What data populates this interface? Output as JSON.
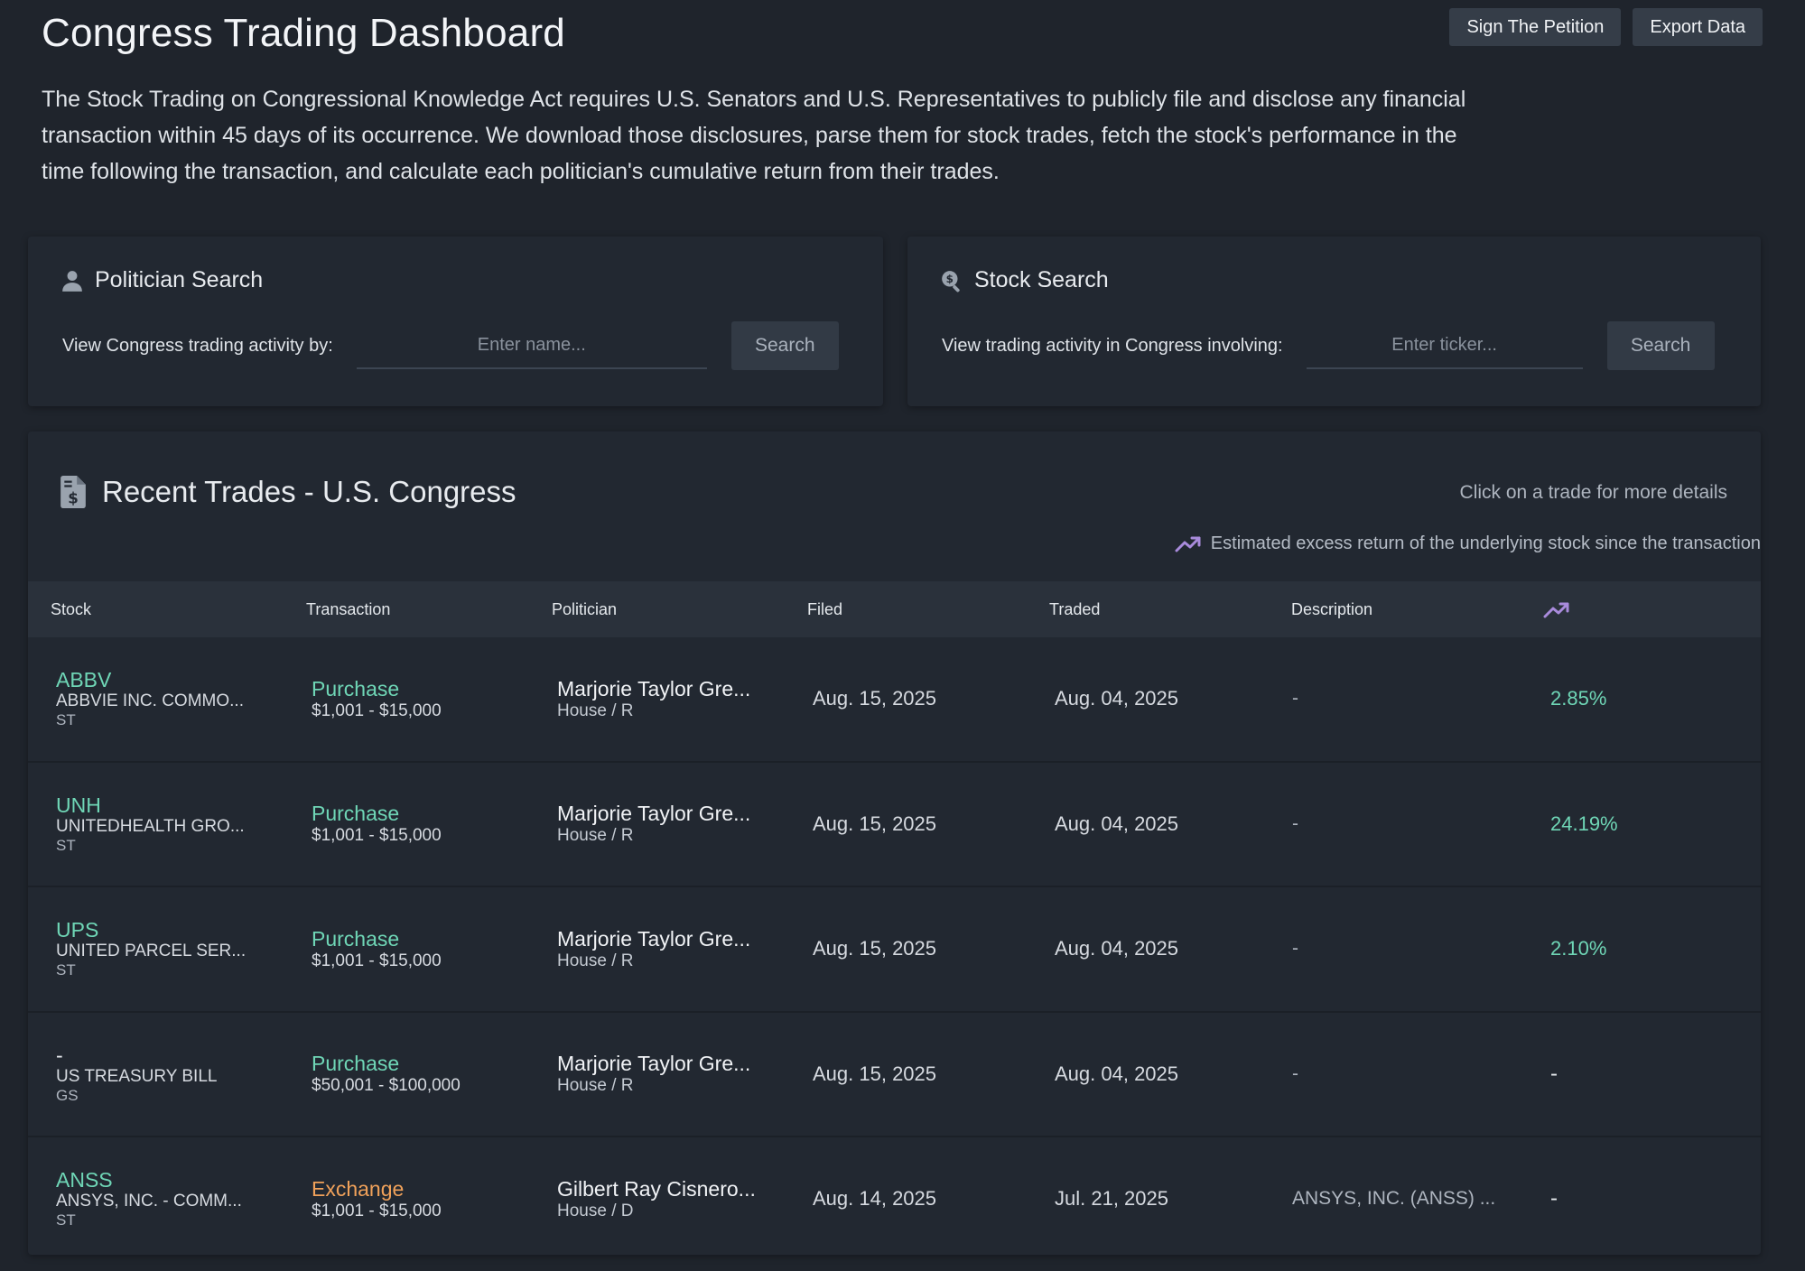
{
  "header": {
    "title": "Congress Trading Dashboard",
    "buttons": {
      "petition": "Sign The Petition",
      "export": "Export Data"
    },
    "intro": "The Stock Trading on Congressional Knowledge Act requires U.S. Senators and U.S. Representatives to publicly file and disclose any financial transaction within 45 days of its occurrence. We download those disclosures, parse them for stock trades, fetch the stock's performance in the time following the transaction, and calculate each politician's cumulative return from their trades."
  },
  "politician_search": {
    "title": "Politician Search",
    "icon": "person-icon",
    "label": "View Congress trading activity by:",
    "placeholder": "Enter name...",
    "button": "Search"
  },
  "stock_search": {
    "title": "Stock Search",
    "icon": "search-dollar-icon",
    "label": "View trading activity in Congress involving:",
    "placeholder": "Enter ticker...",
    "button": "Search"
  },
  "recent_trades": {
    "title": "Recent Trades - U.S. Congress",
    "icon": "invoice-dollar-icon",
    "hint": "Click on a trade for more details",
    "legend_note": "Estimated excess return of the underlying stock since the transaction",
    "legend_icon": "trending-up-icon",
    "columns": {
      "stock": "Stock",
      "transaction": "Transaction",
      "politician": "Politician",
      "filed": "Filed",
      "traded": "Traded",
      "description": "Description"
    },
    "rows": [
      {
        "ticker": "ABBV",
        "company": "ABBVIE INC. COMMO...",
        "asset_type": "ST",
        "transaction": "Purchase",
        "amount": "$1,001 - $15,000",
        "politician": "Marjorie Taylor Gre...",
        "chamber": "House / R",
        "filed": "Aug. 15, 2025",
        "traded": "Aug. 04, 2025",
        "description": "-",
        "return": "2.85%"
      },
      {
        "ticker": "UNH",
        "company": "UNITEDHEALTH GRO...",
        "asset_type": "ST",
        "transaction": "Purchase",
        "amount": "$1,001 - $15,000",
        "politician": "Marjorie Taylor Gre...",
        "chamber": "House / R",
        "filed": "Aug. 15, 2025",
        "traded": "Aug. 04, 2025",
        "description": "-",
        "return": "24.19%"
      },
      {
        "ticker": "UPS",
        "company": "UNITED PARCEL SER...",
        "asset_type": "ST",
        "transaction": "Purchase",
        "amount": "$1,001 - $15,000",
        "politician": "Marjorie Taylor Gre...",
        "chamber": "House / R",
        "filed": "Aug. 15, 2025",
        "traded": "Aug. 04, 2025",
        "description": "-",
        "return": "2.10%"
      },
      {
        "ticker": "-",
        "company": "US TREASURY BILL",
        "asset_type": "GS",
        "transaction": "Purchase",
        "amount": "$50,001 - $100,000",
        "politician": "Marjorie Taylor Gre...",
        "chamber": "House / R",
        "filed": "Aug. 15, 2025",
        "traded": "Aug. 04, 2025",
        "description": "-",
        "return": "-"
      },
      {
        "ticker": "ANSS",
        "company": "ANSYS, INC. - COMM...",
        "asset_type": "ST",
        "transaction": "Exchange",
        "amount": "$1,001 - $15,000",
        "politician": "Gilbert Ray Cisnero...",
        "chamber": "House / D",
        "filed": "Aug. 14, 2025",
        "traded": "Jul. 21, 2025",
        "description": "ANSYS, INC. (ANSS) ...",
        "return": "-"
      }
    ]
  },
  "colors": {
    "background": "#1f242c",
    "panel": "#222831",
    "accent_green": "#6fd6b6",
    "exchange_orange": "#f0a15a",
    "trend_purple": "#a98bdc"
  }
}
